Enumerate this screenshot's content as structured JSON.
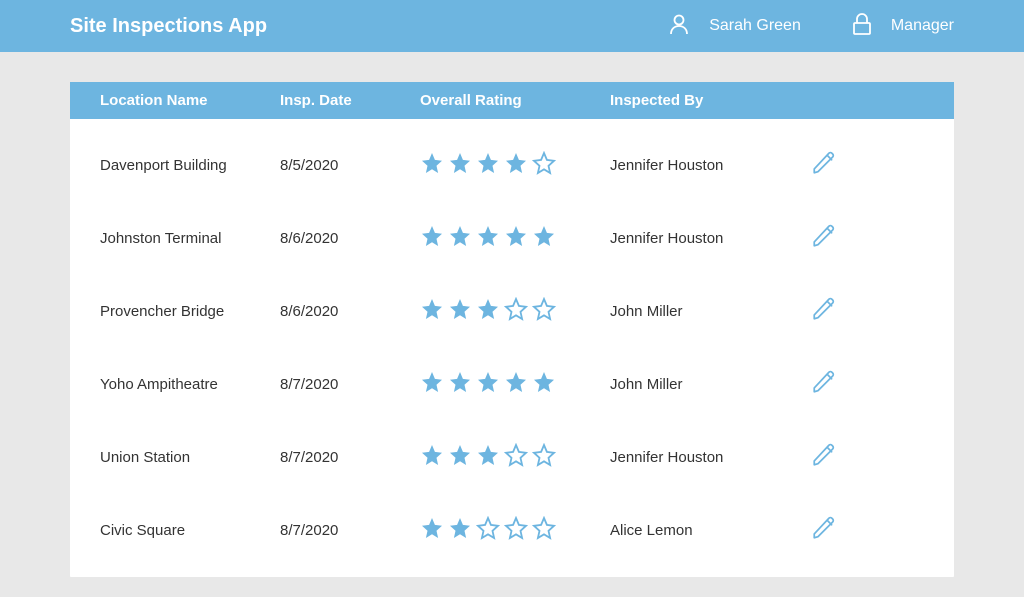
{
  "header": {
    "app_title": "Site Inspections App",
    "user_name": "Sarah Green",
    "role_name": "Manager"
  },
  "colors": {
    "primary": "#6db5e0",
    "star_fill": "#6db5e0",
    "star_outline": "#6db5e0",
    "pencil": "#6db5e0"
  },
  "table": {
    "headers": {
      "location": "Location Name",
      "date": "Insp. Date",
      "rating": "Overall Rating",
      "inspector": "Inspected By"
    },
    "rows": [
      {
        "location": "Davenport Building",
        "date": "8/5/2020",
        "rating": 4,
        "max_rating": 5,
        "inspector": "Jennifer Houston"
      },
      {
        "location": "Johnston Terminal",
        "date": "8/6/2020",
        "rating": 5,
        "max_rating": 5,
        "inspector": "Jennifer Houston"
      },
      {
        "location": "Provencher Bridge",
        "date": "8/6/2020",
        "rating": 3,
        "max_rating": 5,
        "inspector": "John Miller"
      },
      {
        "location": "Yoho Ampitheatre",
        "date": "8/7/2020",
        "rating": 5,
        "max_rating": 5,
        "inspector": "John Miller"
      },
      {
        "location": "Union Station",
        "date": "8/7/2020",
        "rating": 3,
        "max_rating": 5,
        "inspector": "Jennifer Houston"
      },
      {
        "location": "Civic Square",
        "date": "8/7/2020",
        "rating": 2,
        "max_rating": 5,
        "inspector": "Alice Lemon"
      }
    ]
  }
}
